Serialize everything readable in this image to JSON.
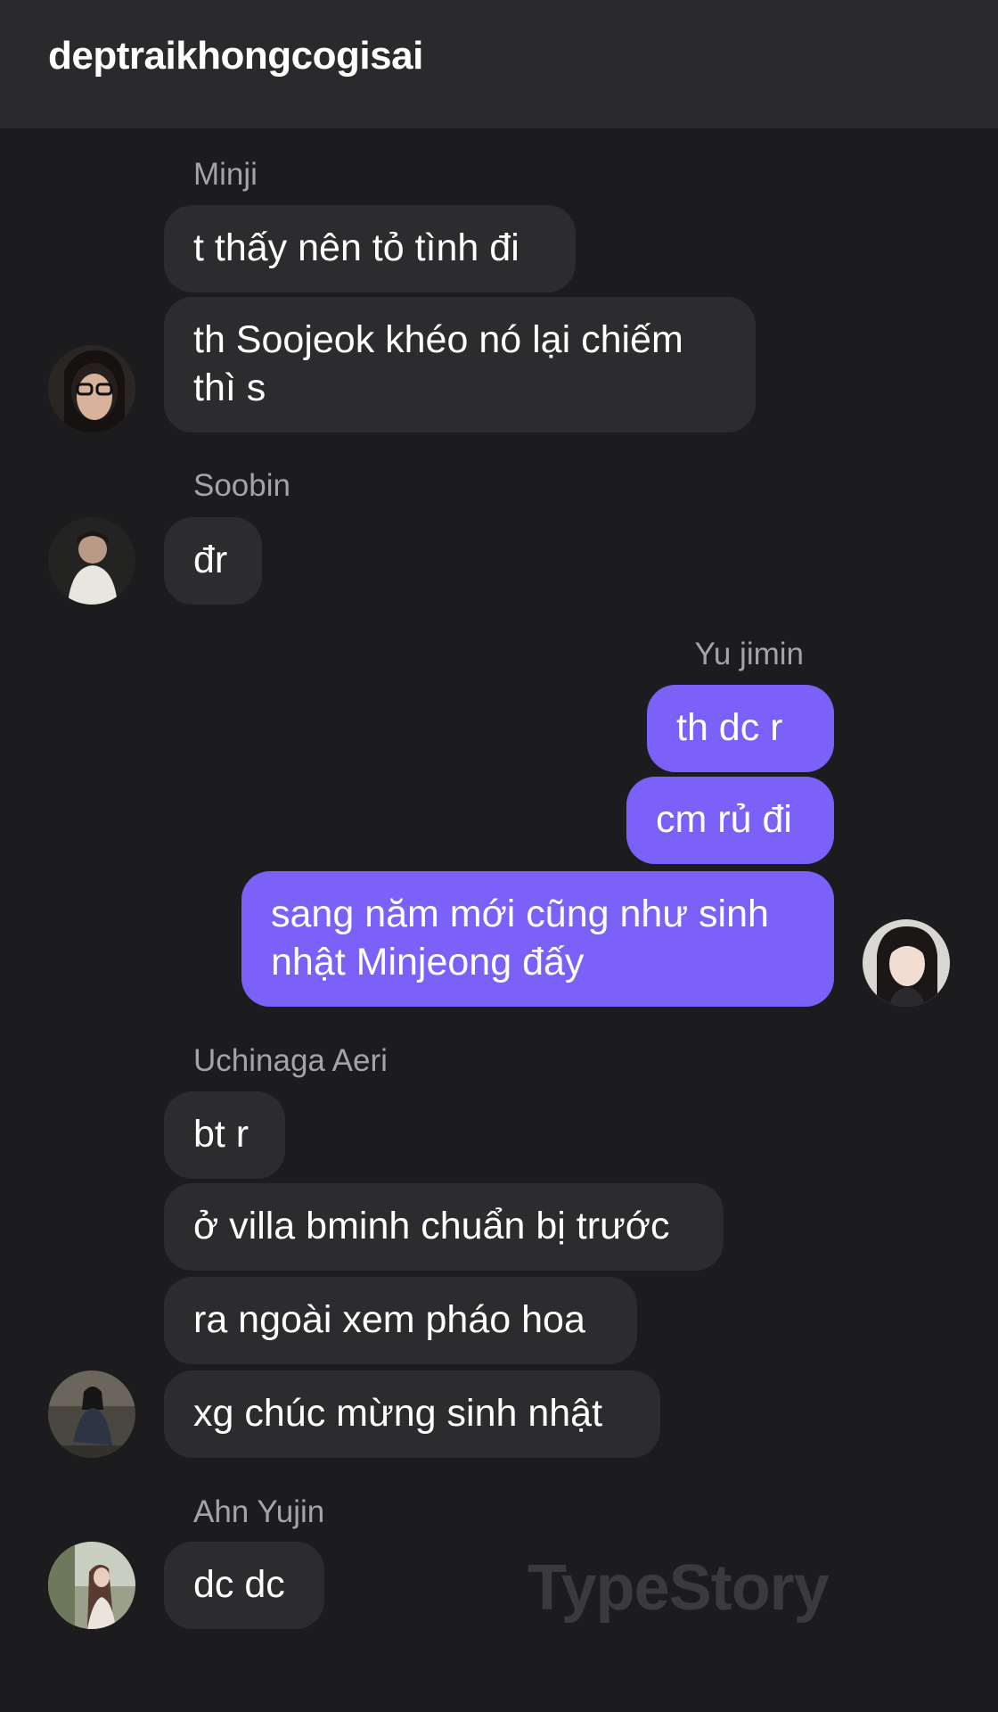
{
  "header": {
    "title": "deptraikhongcogisai"
  },
  "groups": [
    {
      "sender": "Minji",
      "messages": [
        "t thấy nên tỏ tình đi",
        "th Soojeok khéo nó lại chiếm thì s"
      ],
      "avatar": "minji-avatar"
    },
    {
      "sender": "Soobin",
      "messages": [
        "đr"
      ],
      "avatar": "soobin-avatar"
    },
    {
      "sender": "Yu jimin",
      "messages": [
        "th dc r",
        "cm rủ đi",
        "sang năm mới cũng như sinh nhật Minjeong đấy"
      ],
      "avatar": "yujimin-avatar"
    },
    {
      "sender": "Uchinaga Aeri",
      "messages": [
        "bt r",
        "ở villa bminh chuẩn bị trước",
        "ra ngoài xem pháo hoa",
        "xg chúc mừng sinh nhật"
      ],
      "avatar": "aeri-avatar"
    },
    {
      "sender": "Ahn Yujin",
      "messages": [
        "dc dc"
      ],
      "avatar": "yujin-avatar"
    }
  ],
  "watermark": "TypeStory",
  "colors": {
    "background": "#1c1c1e",
    "header": "#2a2a2c",
    "incoming_bubble": "#2c2c2e",
    "outgoing_bubble": "#7b61f8",
    "sender_label": "#a3a3a8"
  }
}
